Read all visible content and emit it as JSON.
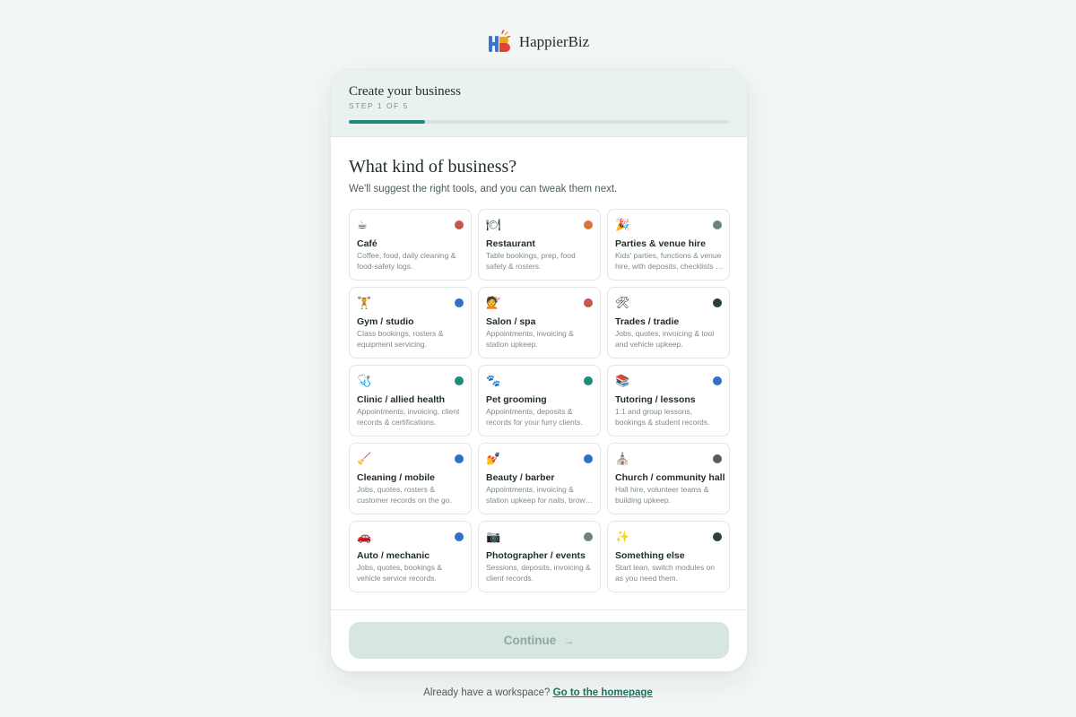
{
  "brand": {
    "name": "HappierBiz",
    "logo_icon": "hb-logo-icon"
  },
  "header": {
    "title": "Create your business",
    "step": "STEP 1 OF 5",
    "progress": 0.2,
    "accent": "#1e8c78"
  },
  "main": {
    "question": "What kind of business?",
    "subtitle": "We'll suggest the right tools, and you can tweak them next.",
    "options": [
      {
        "icon": "☕",
        "icon_name": "coffee-icon",
        "name": "Café",
        "desc": "Coffee, food, daily cleaning & food-safety logs.",
        "dot": "#c4564a"
      },
      {
        "icon": "🍽",
        "icon_name": "plate-cutlery-icon",
        "name": "Restaurant",
        "desc": "Table bookings, prep, food safety & rosters.",
        "dot": "#d9713a"
      },
      {
        "icon": "🎉",
        "icon_name": "party-popper-icon",
        "name": "Parties & venue hire",
        "desc": "Kids' parties, functions & venue hire, with deposits, checklists & more.",
        "dot": "#6f8478"
      },
      {
        "icon": "🏋",
        "icon_name": "weightlifter-icon",
        "name": "Gym / studio",
        "desc": "Class bookings, rosters & equipment servicing.",
        "dot": "#2f6fc4"
      },
      {
        "icon": "💇",
        "icon_name": "haircut-icon",
        "name": "Salon / spa",
        "desc": "Appointments, invoicing & station upkeep.",
        "dot": "#c4564a"
      },
      {
        "icon": "🛠",
        "icon_name": "tools-icon",
        "name": "Trades / tradie",
        "desc": "Jobs, quotes, invoicing & tool and vehicle upkeep.",
        "dot": "#2b4038"
      },
      {
        "icon": "🩺",
        "icon_name": "stethoscope-icon",
        "name": "Clinic / allied health",
        "desc": "Appointments, invoicing, client records & certifications.",
        "dot": "#1e8c78"
      },
      {
        "icon": "🐾",
        "icon_name": "paw-prints-icon",
        "name": "Pet grooming",
        "desc": "Appointments, deposits & records for your furry clients.",
        "dot": "#1e8c78"
      },
      {
        "icon": "📚",
        "icon_name": "books-icon",
        "name": "Tutoring / lessons",
        "desc": "1:1 and group lessons, bookings & student records.",
        "dot": "#2f6fc4"
      },
      {
        "icon": "🧹",
        "icon_name": "broom-icon",
        "name": "Cleaning / mobile",
        "desc": "Jobs, quotes, rosters & customer records on the go.",
        "dot": "#2f6fc4"
      },
      {
        "icon": "💅",
        "icon_name": "nail-polish-icon",
        "name": "Beauty / barber",
        "desc": "Appointments, invoicing & station upkeep for nails, brows & barbering.",
        "dot": "#2f6fc4"
      },
      {
        "icon": "⛪",
        "icon_name": "church-icon",
        "name": "Church / community hall",
        "desc": "Hall hire, volunteer teams & building upkeep.",
        "dot": "#4d6159"
      },
      {
        "icon": "🚗",
        "icon_name": "car-icon",
        "name": "Auto / mechanic",
        "desc": "Jobs, quotes, bookings & vehicle service records.",
        "dot": "#2f6fc4"
      },
      {
        "icon": "📷",
        "icon_name": "camera-icon",
        "name": "Photographer / events",
        "desc": "Sessions, deposits, invoicing & client records.",
        "dot": "#6f8478"
      },
      {
        "icon": "✨",
        "icon_name": "sparkles-icon",
        "name": "Something else",
        "desc": "Start lean, switch modules on as you need them.",
        "dot": "#2b4038"
      }
    ]
  },
  "footer": {
    "continue_label": "Continue",
    "continue_icon": "arrow-right-icon",
    "prompt": "Already have a workspace?",
    "link": "Go to the homepage"
  }
}
